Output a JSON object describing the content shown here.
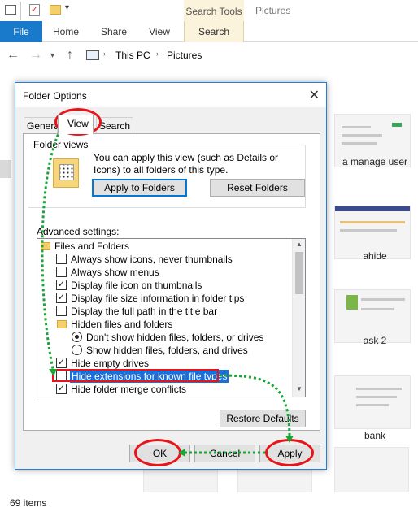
{
  "explorer": {
    "search_tools_tab": "Search Tools",
    "window_title": "Pictures",
    "ribbon_tabs": [
      "File",
      "Home",
      "Share",
      "View",
      "Search"
    ],
    "breadcrumb": [
      "This PC",
      "Pictures"
    ],
    "thumbnails": [
      {
        "label": "a manage user"
      },
      {
        "label": "ahide"
      },
      {
        "label": "ask 2"
      },
      {
        "label": "bank"
      }
    ],
    "status_count": "69 items"
  },
  "dialog": {
    "title": "Folder Options",
    "tabs": [
      "General",
      "View",
      "Search"
    ],
    "active_tab": "View",
    "folder_views": {
      "legend": "Folder views",
      "text": "You can apply this view (such as Details or Icons) to all folders of this type.",
      "apply_button": "Apply to Folders",
      "reset_button": "Reset Folders"
    },
    "advanced_label": "Advanced settings:",
    "tree": [
      {
        "kind": "folder",
        "label": "Files and Folders"
      },
      {
        "kind": "checkbox",
        "checked": false,
        "label": "Always show icons, never thumbnails"
      },
      {
        "kind": "checkbox",
        "checked": false,
        "label": "Always show menus"
      },
      {
        "kind": "checkbox",
        "checked": true,
        "label": "Display file icon on thumbnails"
      },
      {
        "kind": "checkbox",
        "checked": true,
        "label": "Display file size information in folder tips"
      },
      {
        "kind": "checkbox",
        "checked": false,
        "label": "Display the full path in the title bar"
      },
      {
        "kind": "folder",
        "label": "Hidden files and folders"
      },
      {
        "kind": "radio",
        "checked": true,
        "label": "Don't show hidden files, folders, or drives"
      },
      {
        "kind": "radio",
        "checked": false,
        "label": "Show hidden files, folders, and drives"
      },
      {
        "kind": "checkbox",
        "checked": true,
        "label": "Hide empty drives"
      },
      {
        "kind": "checkbox",
        "checked": false,
        "label": "Hide extensions for known file types",
        "selected": true
      },
      {
        "kind": "checkbox",
        "checked": true,
        "label": "Hide folder merge conflicts"
      }
    ],
    "restore_button": "Restore Defaults",
    "ok_button": "OK",
    "cancel_button": "Cancel",
    "apply_button": "Apply"
  },
  "colors": {
    "accent_blue": "#1979ca",
    "selection_blue": "#1a6fd8",
    "annotation_red": "#e8141a",
    "annotation_green": "#1aa336",
    "search_tools_bg": "#fcf3dc"
  }
}
